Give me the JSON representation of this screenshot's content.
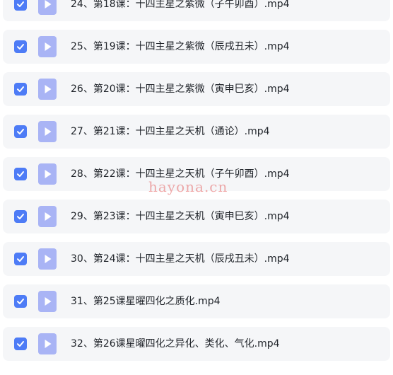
{
  "colors": {
    "checkbox": "#4e7cf6",
    "file_icon": "#a9b4f5",
    "row_background": "#f5f6f8",
    "text": "#1f2329",
    "watermark": "#e24646"
  },
  "icons": {
    "checkbox": "checkmark-icon",
    "file": "video-file-icon"
  },
  "files": [
    {
      "checked": true,
      "name": "24、第18课：十四主星之紫微（子午卯酉）.mp4"
    },
    {
      "checked": true,
      "name": "25、第19课：十四主星之紫微（辰戌丑未）.mp4"
    },
    {
      "checked": true,
      "name": "26、第20课：十四主星之紫微（寅申巳亥）.mp4"
    },
    {
      "checked": true,
      "name": "27、第21课：十四主星之天机（通论）.mp4"
    },
    {
      "checked": true,
      "name": "28、第22课：十四主星之天机（子午卯酉）.mp4"
    },
    {
      "checked": true,
      "name": "29、第23课：十四主星之天机（寅申巳亥）.mp4"
    },
    {
      "checked": true,
      "name": "30、第24课：十四主星之天机（辰戌丑未）.mp4"
    },
    {
      "checked": true,
      "name": "31、第25课星曜四化之质化.mp4"
    },
    {
      "checked": true,
      "name": "32、第26课星曜四化之异化、类化、气化.mp4"
    }
  ],
  "watermark": "hayona.cn"
}
